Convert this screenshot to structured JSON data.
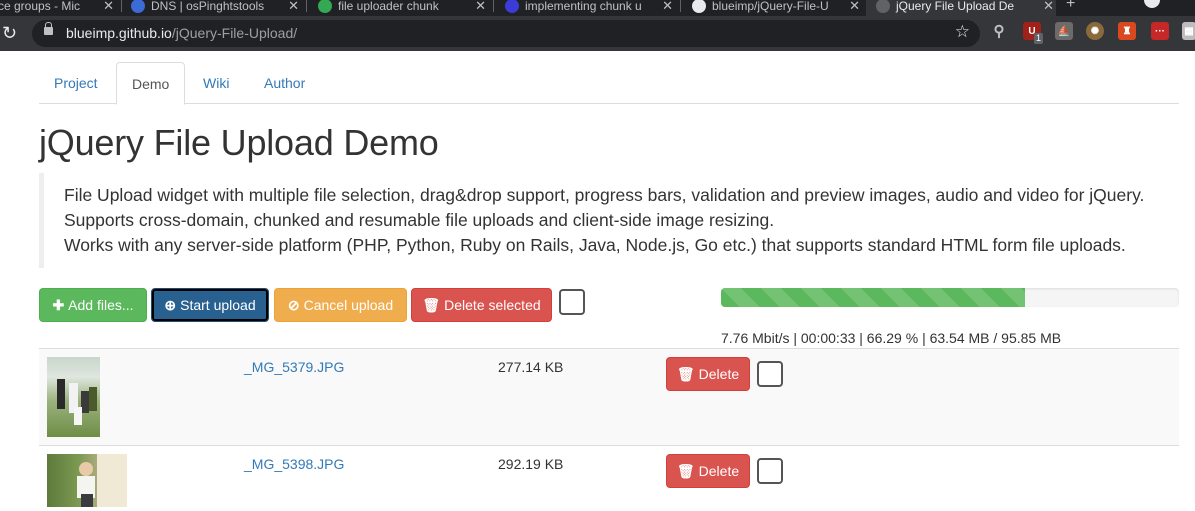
{
  "browser": {
    "tabs": [
      {
        "title": "ce groups - Mic"
      },
      {
        "title": "DNS | osPinghtstools"
      },
      {
        "title": "file uploader chunk"
      },
      {
        "title": "implementing chunk u"
      },
      {
        "title": "blueimp/jQuery-File-U"
      },
      {
        "title": "jQuery File Upload De"
      }
    ],
    "url_host": "blueimp.github.io",
    "url_path": "/jQuery-File-Upload/",
    "ext_badge": "1"
  },
  "nav": {
    "tabs": [
      {
        "label": "Project"
      },
      {
        "label": "Demo"
      },
      {
        "label": "Wiki"
      },
      {
        "label": "Author"
      }
    ],
    "active": "Demo"
  },
  "page": {
    "title": "jQuery File Upload Demo",
    "lead": [
      "File Upload widget with multiple file selection, drag&drop support, progress bars, validation and preview images, audio and video for jQuery.",
      "Supports cross-domain, chunked and resumable file uploads and client-side image resizing.",
      "Works with any server-side platform (PHP, Python, Ruby on Rails, Java, Node.js, Go etc.) that supports standard HTML form file uploads."
    ]
  },
  "toolbar": {
    "add_label": "Add files...",
    "start_label": "Start upload",
    "cancel_label": "Cancel upload",
    "delete_label": "Delete selected"
  },
  "progress": {
    "percent": 66.29,
    "text": "7.76 Mbit/s | 00:00:33 | 66.29 % | 63.54 MB / 95.85 MB"
  },
  "files": [
    {
      "name": "_MG_5379.JPG",
      "size": "277.14 KB",
      "delete_label": "Delete"
    },
    {
      "name": "_MG_5398.JPG",
      "size": "292.19 KB",
      "delete_label": "Delete"
    }
  ],
  "colors": {
    "success": "#5cb85c",
    "primary": "#286090",
    "warning": "#f0ad4e",
    "danger": "#d9534f",
    "link": "#337ab7"
  }
}
